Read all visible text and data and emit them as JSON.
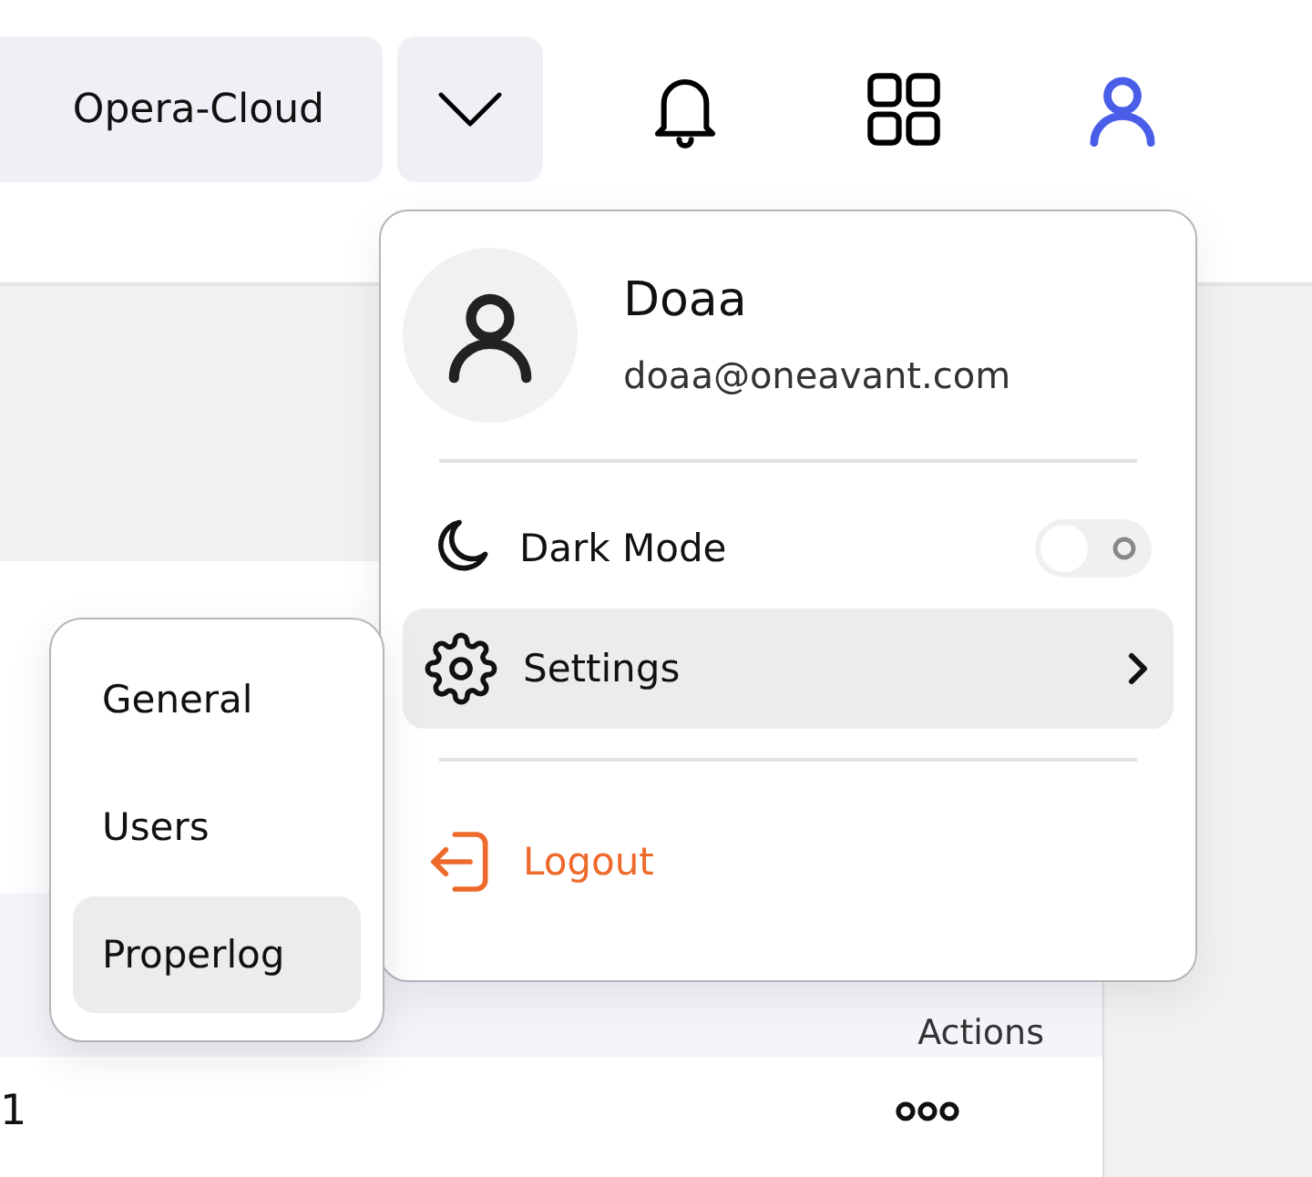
{
  "header": {
    "workspace": "Opera-Cloud"
  },
  "table": {
    "columns": [
      "Actions"
    ],
    "rows": [
      {
        "column_1": "1"
      }
    ]
  },
  "profile_menu": {
    "name": "Doaa",
    "email": "doaa@oneavant.com",
    "items": [
      {
        "kind": "toggle",
        "label": "Dark Mode",
        "on": false
      },
      {
        "kind": "submenu",
        "label": "Settings",
        "selected": true
      },
      {
        "kind": "action",
        "label": "Logout"
      }
    ]
  },
  "settings_submenu": {
    "items": [
      {
        "label": "General",
        "selected": false
      },
      {
        "label": "Users",
        "selected": false
      },
      {
        "label": "Properlog",
        "selected": true
      }
    ]
  }
}
